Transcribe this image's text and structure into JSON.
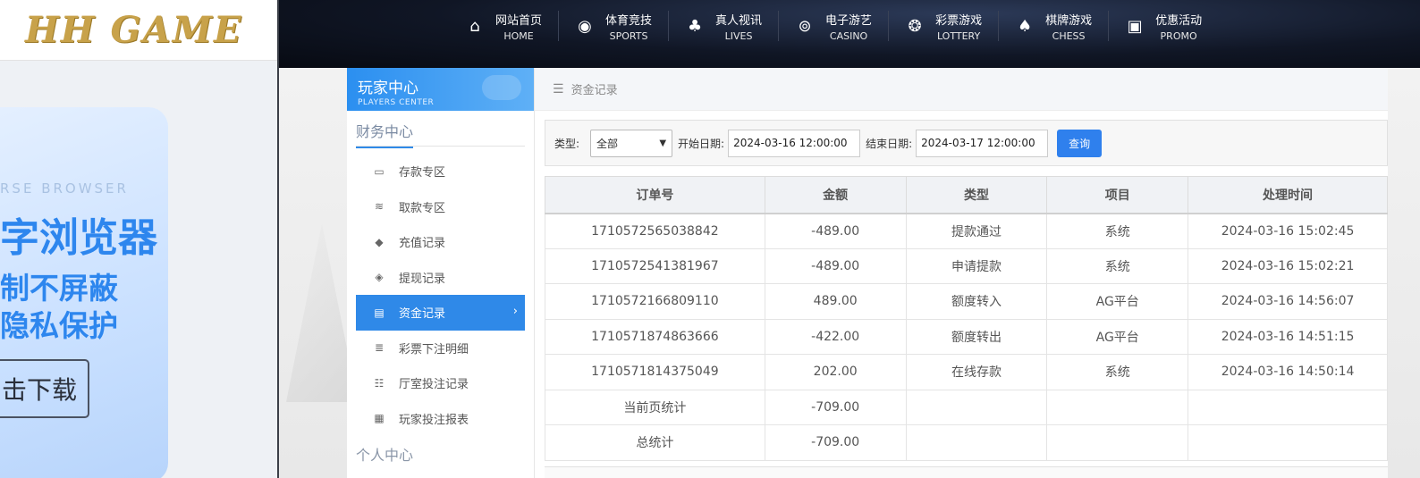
{
  "brand": {
    "logo": "HH GAME"
  },
  "promo": {
    "subtitle": "RSE BROWSER",
    "line1": "字浏览器",
    "line2": "制不屏蔽",
    "line3": "隐私保护",
    "button": "击下载"
  },
  "nav": [
    {
      "zh": "网站首页",
      "en": "HOME",
      "icon": "home-icon"
    },
    {
      "zh": "体育竞技",
      "en": "SPORTS",
      "icon": "basketball-icon"
    },
    {
      "zh": "真人视讯",
      "en": "LIVES",
      "icon": "cards-icon"
    },
    {
      "zh": "电子游艺",
      "en": "CASINO",
      "icon": "joystick-icon"
    },
    {
      "zh": "彩票游戏",
      "en": "LOTTERY",
      "icon": "lottery-balls-icon"
    },
    {
      "zh": "棋牌游戏",
      "en": "CHESS",
      "icon": "spade-icon"
    },
    {
      "zh": "优惠活动",
      "en": "PROMO",
      "icon": "gift-icon"
    }
  ],
  "sidebar": {
    "title": "玩家中心",
    "subtitle": "PLAYERS CENTER",
    "section1": "财务中心",
    "items": [
      {
        "label": "存款专区",
        "icon": "deposit-card-icon"
      },
      {
        "label": "取款专区",
        "icon": "withdraw-cash-icon"
      },
      {
        "label": "充值记录",
        "icon": "money-bag-icon"
      },
      {
        "label": "提现记录",
        "icon": "wallet-icon"
      },
      {
        "label": "资金记录",
        "icon": "funds-record-icon",
        "active": true
      },
      {
        "label": "彩票下注明细",
        "icon": "lottery-list-icon"
      },
      {
        "label": "厅室投注记录",
        "icon": "bet-list-icon"
      },
      {
        "label": "玩家投注报表",
        "icon": "report-icon"
      }
    ],
    "section2": "个人中心"
  },
  "breadcrumb": {
    "label": "资金记录"
  },
  "filter": {
    "type_label": "类型:",
    "type_value": "全部",
    "start_label": "开始日期:",
    "start_value": "2024-03-16 12:00:00",
    "end_label": "结束日期:",
    "end_value": "2024-03-17 12:00:00",
    "query_button": "查询"
  },
  "table": {
    "headers": [
      "订单号",
      "金额",
      "类型",
      "项目",
      "处理时间"
    ],
    "rows": [
      [
        "1710572565038842",
        "-489.00",
        "提款通过",
        "系统",
        "2024-03-16 15:02:45"
      ],
      [
        "1710572541381967",
        "-489.00",
        "申请提款",
        "系统",
        "2024-03-16 15:02:21"
      ],
      [
        "1710572166809110",
        "489.00",
        "额度转入",
        "AG平台",
        "2024-03-16 14:56:07"
      ],
      [
        "1710571874863666",
        "-422.00",
        "额度转出",
        "AG平台",
        "2024-03-16 14:51:15"
      ],
      [
        "1710571814375049",
        "202.00",
        "在线存款",
        "系统",
        "2024-03-16 14:50:14"
      ],
      [
        "当前页统计",
        "-709.00",
        "",
        "",
        ""
      ],
      [
        "总统计",
        "-709.00",
        "",
        "",
        ""
      ]
    ]
  },
  "colors": {
    "accent": "#2f89e8",
    "nav_bg": "#101625",
    "gold": "#c8a24a"
  }
}
